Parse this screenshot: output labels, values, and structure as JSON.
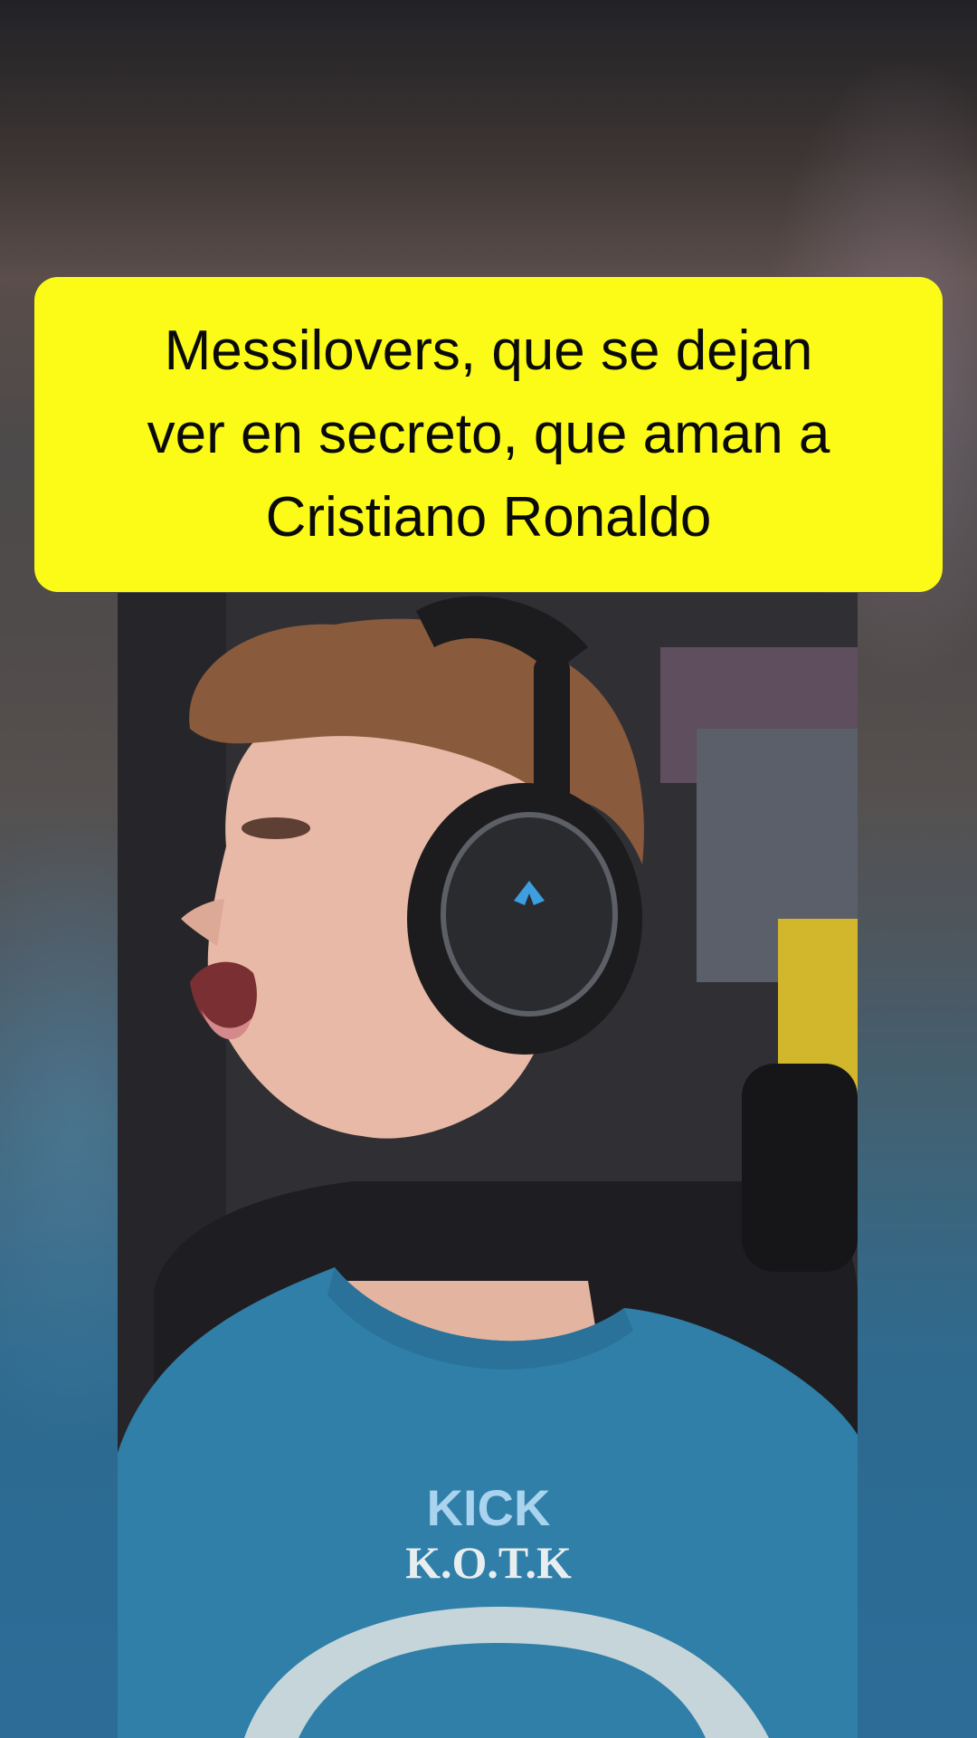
{
  "caption": {
    "lines": [
      "Messilovers, que se dejan",
      "ver en secreto, que aman a",
      "Cristiano Ronaldo"
    ],
    "background_color": "#fbfb17",
    "text_color": "#0a0a0a"
  },
  "video": {
    "shirt_brand_top": "KICK",
    "shirt_brand_sub": "K.O.T.K"
  },
  "colors": {
    "shirt": "#2f7fa8",
    "headphones": "#1c1c1e",
    "hair": "#8a5a3c"
  }
}
